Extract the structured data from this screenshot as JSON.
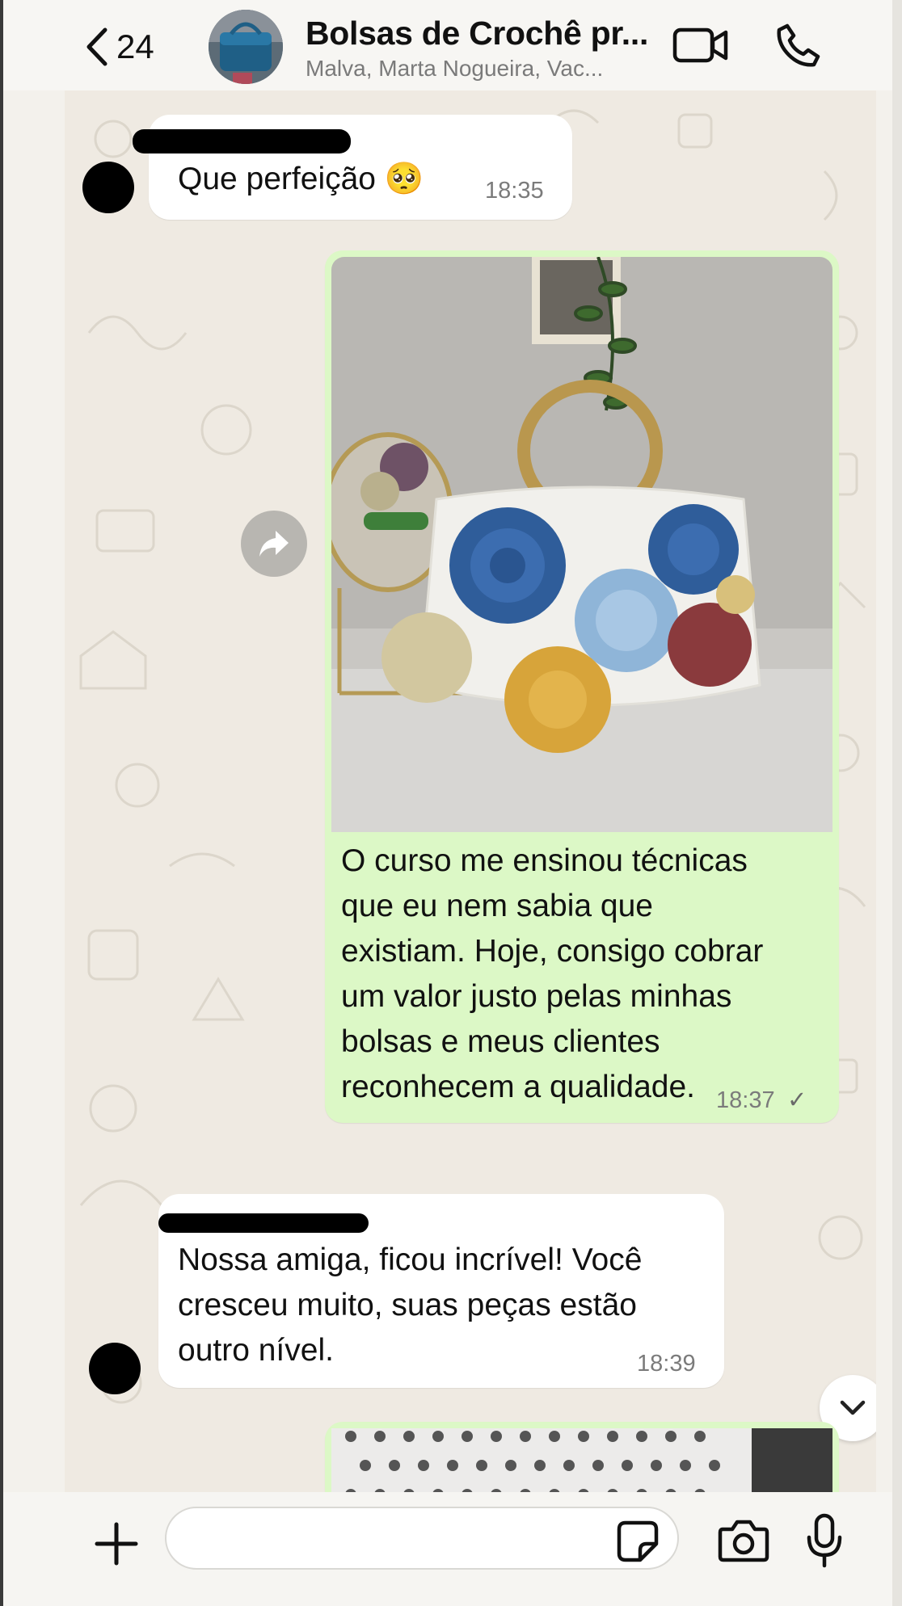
{
  "header": {
    "back_count": "24",
    "title": "Bolsas de Crochê pr...",
    "subtitle": "Malva, Marta Nogueira, Vac..."
  },
  "messages": [
    {
      "direction": "in",
      "text": "Que perfeição 🥺",
      "time": "18:35"
    },
    {
      "direction": "out",
      "type": "image-caption",
      "lines": [
        "O curso me ensinou técnicas",
        "que eu nem sabia que",
        "existiam. Hoje, consigo cobrar",
        "um valor justo pelas minhas",
        "bolsas e meus clientes",
        "reconhecem a qualidade."
      ],
      "time": "18:37",
      "status": "✓"
    },
    {
      "direction": "in",
      "lines": [
        "Nossa amiga, ficou incrível! Você",
        "cresceu muito, suas peças estão",
        "outro nível."
      ],
      "time": "18:39"
    }
  ],
  "composer": {
    "placeholder": ""
  },
  "colors": {
    "incoming": "#ffffff",
    "outgoing": "#dcf8c6",
    "chat_bg": "#efeae2"
  }
}
